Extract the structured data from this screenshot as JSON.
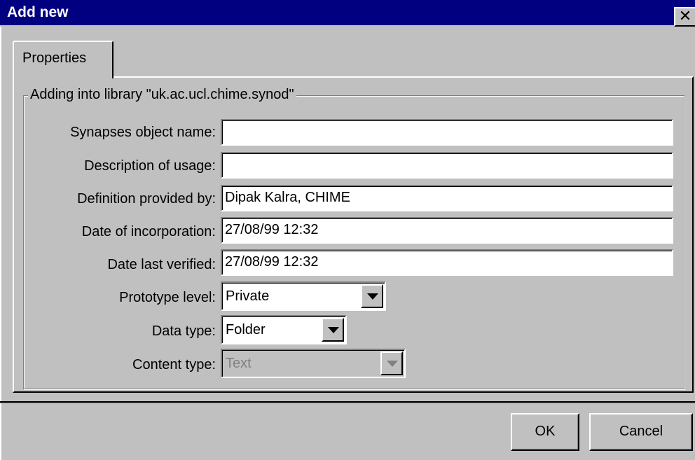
{
  "window": {
    "title": "Add new",
    "close_glyph": "✕"
  },
  "tabs": [
    {
      "label": "Properties",
      "selected": true
    }
  ],
  "group": {
    "legend": "Adding into library \"uk.ac.ucl.chime.synod\""
  },
  "fields": {
    "object_name": {
      "label": "Synapses object name:",
      "value": ""
    },
    "description": {
      "label": "Description of usage:",
      "value": ""
    },
    "provided_by": {
      "label": "Definition provided by:",
      "value": "Dipak Kalra, CHIME"
    },
    "date_incorporation": {
      "label": "Date of incorporation:",
      "value": "27/08/99 12:32"
    },
    "date_verified": {
      "label": "Date last verified:",
      "value": "27/08/99 12:32"
    },
    "prototype_level": {
      "label": "Prototype level:",
      "value": "Private"
    },
    "data_type": {
      "label": "Data type:",
      "value": "Folder"
    },
    "content_type": {
      "label": "Content type:",
      "value": "Text",
      "disabled": true
    }
  },
  "buttons": {
    "ok": "OK",
    "cancel": "Cancel"
  },
  "colors": {
    "titlebar": "#000080",
    "face": "#c0c0c0",
    "field": "#ffffff",
    "disabled_text": "#808080"
  }
}
